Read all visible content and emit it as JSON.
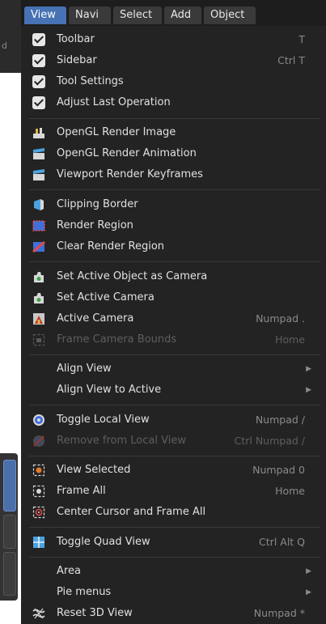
{
  "menubar": {
    "tabs": [
      "View",
      "Navi",
      "Select",
      "Add",
      "Object"
    ]
  },
  "left_strip": {
    "fragment": "d"
  },
  "menu": {
    "items": [
      {
        "label": "Toolbar",
        "shortcut": "T",
        "icon": "checkbox-checked-icon"
      },
      {
        "label": "Sidebar",
        "shortcut": "Ctrl T",
        "icon": "checkbox-checked-icon"
      },
      {
        "label": "Tool Settings",
        "shortcut": "",
        "icon": "checkbox-checked-icon"
      },
      {
        "label": "Adjust Last Operation",
        "shortcut": "",
        "icon": "checkbox-checked-icon"
      },
      {
        "label": "OpenGL Render Image",
        "shortcut": "",
        "icon": "render-image-icon"
      },
      {
        "label": "OpenGL Render Animation",
        "shortcut": "",
        "icon": "render-animation-icon"
      },
      {
        "label": "Viewport Render Keyframes",
        "shortcut": "",
        "icon": "render-keyframes-icon"
      },
      {
        "label": "Clipping Border",
        "shortcut": "",
        "icon": "clipping-border-icon"
      },
      {
        "label": "Render Region",
        "shortcut": "",
        "icon": "render-region-icon"
      },
      {
        "label": "Clear Render Region",
        "shortcut": "",
        "icon": "clear-render-region-icon"
      },
      {
        "label": "Set Active Object as Camera",
        "shortcut": "",
        "icon": "camera-icon"
      },
      {
        "label": "Set Active Camera",
        "shortcut": "",
        "icon": "camera-icon"
      },
      {
        "label": "Active Camera",
        "shortcut": "Numpad .",
        "icon": "active-camera-icon"
      },
      {
        "label": "Frame Camera Bounds",
        "shortcut": "Home",
        "icon": "frame-camera-icon"
      },
      {
        "label": "Align View",
        "shortcut": "",
        "icon": ""
      },
      {
        "label": "Align View to Active",
        "shortcut": "",
        "icon": ""
      },
      {
        "label": "Toggle Local View",
        "shortcut": "Numpad /",
        "icon": "local-view-icon"
      },
      {
        "label": "Remove from Local View",
        "shortcut": "Ctrl Numpad /",
        "icon": "remove-local-view-icon"
      },
      {
        "label": "View Selected",
        "shortcut": "Numpad 0",
        "icon": "view-selected-icon"
      },
      {
        "label": "Frame All",
        "shortcut": "Home",
        "icon": "frame-all-icon"
      },
      {
        "label": "Center Cursor and Frame All",
        "shortcut": "",
        "icon": "center-cursor-icon"
      },
      {
        "label": "Toggle Quad View",
        "shortcut": "Ctrl Alt Q",
        "icon": "quad-view-icon"
      },
      {
        "label": "Area",
        "shortcut": "",
        "icon": ""
      },
      {
        "label": "Pie menus",
        "shortcut": "",
        "icon": ""
      },
      {
        "label": "Reset 3D View",
        "shortcut": "Numpad *",
        "icon": "reset-3d-view-icon"
      }
    ],
    "submenu_arrow": "▶"
  }
}
